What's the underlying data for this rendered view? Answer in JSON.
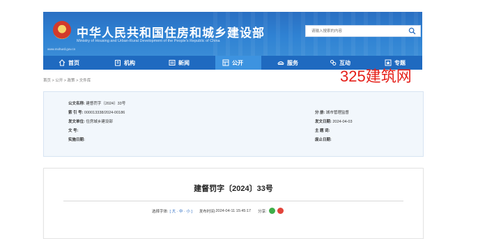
{
  "header": {
    "title": "中华人民共和国住房和城乡建设部",
    "subtitle": "Ministry of Housing and Urban-Rural Development of the People's Republic of China",
    "url": "www.mohurd.gov.cn",
    "search_placeholder": "请输入搜索的内容"
  },
  "nav": {
    "items": [
      {
        "label": "首页",
        "icon": "home-icon"
      },
      {
        "label": "机构",
        "icon": "building-icon"
      },
      {
        "label": "新闻",
        "icon": "news-icon"
      },
      {
        "label": "公开",
        "icon": "public-icon"
      },
      {
        "label": "服务",
        "icon": "service-icon"
      },
      {
        "label": "互动",
        "icon": "interaction-icon"
      },
      {
        "label": "专题",
        "icon": "topic-icon"
      }
    ],
    "active_index": 3
  },
  "watermark": "325建筑网",
  "breadcrumb": "首页 > 公开 > 政策 > 文件库",
  "info": {
    "doc_name_label": "公文名称:",
    "doc_name": "建督罚字〔2024〕33号",
    "index_label": "索 引 号:",
    "index": "000013338/2024-00186",
    "issuer_label": "发文单位:",
    "issuer": "住房城乡建设部",
    "docno_label": "文    号:",
    "docno": "",
    "effective_label": "实施日期:",
    "effective": "",
    "category_label": "分    册:",
    "category": "城市管理监督",
    "issue_date_label": "发文日期:",
    "issue_date": "2024-04-03",
    "topic_label": "主 题 词:",
    "topic": "",
    "expiry_label": "废止日期:",
    "expiry": ""
  },
  "document": {
    "title": "建督罚字〔2024〕33号",
    "font_label": "选择字体:",
    "font_sizes": "[ 大 · 中 · 小 ]",
    "publish_label": "发布时间:",
    "publish_time": "2024-04-11 15:45:17",
    "share_label": "分享:",
    "share_colors": {
      "wechat": "#3fae49",
      "weibo": "#e2443b"
    }
  }
}
